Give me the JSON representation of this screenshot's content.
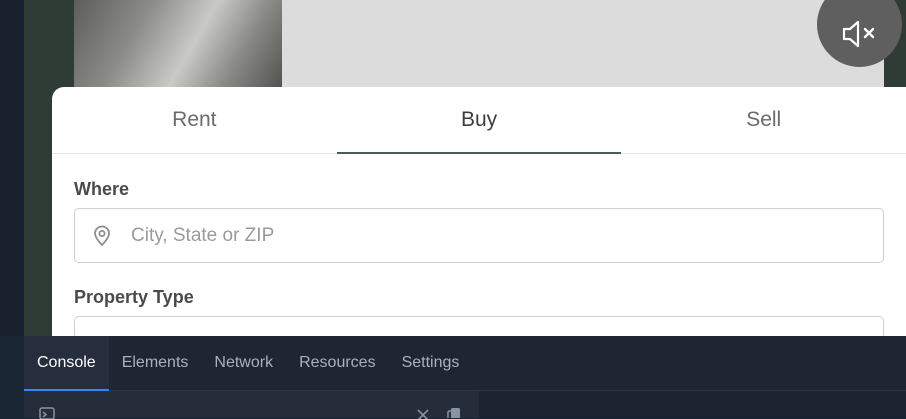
{
  "icons": {
    "mute": "speaker-muted-icon",
    "location": "map-pin-icon",
    "console_prompt": "console-prompt-icon",
    "clear": "close-icon",
    "copy": "copy-icon"
  },
  "search_card": {
    "tabs": [
      {
        "label": "Rent",
        "active": false
      },
      {
        "label": "Buy",
        "active": true
      },
      {
        "label": "Sell",
        "active": false
      }
    ],
    "where": {
      "label": "Where",
      "placeholder": "City, State or ZIP",
      "value": ""
    },
    "property_type": {
      "label": "Property Type"
    }
  },
  "devtools": {
    "tabs": [
      {
        "label": "Console",
        "active": true
      },
      {
        "label": "Elements",
        "active": false
      },
      {
        "label": "Network",
        "active": false
      },
      {
        "label": "Resources",
        "active": false
      },
      {
        "label": "Settings",
        "active": false
      }
    ]
  },
  "colors": {
    "active_devtools_tab_underline": "#3b82f6",
    "active_tab_underline": "#4e5b55",
    "mute_button": "#5f5f5f"
  }
}
